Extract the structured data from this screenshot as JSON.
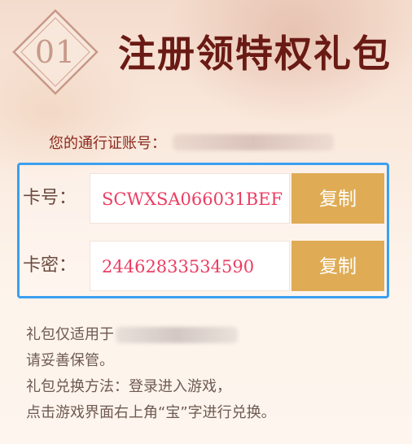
{
  "header": {
    "badge_number": "01",
    "title": "注册领特权礼包"
  },
  "account": {
    "label": "您的通行证账号："
  },
  "codes": {
    "card_label": "卡号：",
    "card_value": "SCWXSA066031BEF",
    "pin_label": "卡密：",
    "pin_value": "24462833534590",
    "copy_label": "复制"
  },
  "notes": {
    "line1": "礼包仅适用于",
    "line2": "请妥善保管。",
    "line3": "礼包兑换方法：登录进入游戏，",
    "line4": "点击游戏界面右上角“宝”字进行兑换。"
  },
  "colors": {
    "title": "#6a1a14",
    "code_text": "#ec3d62",
    "copy_button": "#dfac55",
    "box_border": "#3aa0f0"
  }
}
